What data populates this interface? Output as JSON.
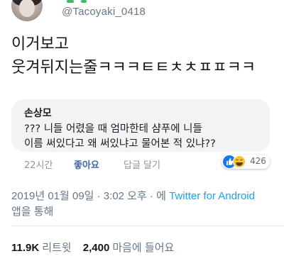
{
  "header": {
    "handle": "@Tacoyaki_0418"
  },
  "tweet": {
    "line1": "이거보고",
    "line2": "웃겨뒤지는줄ㅋㅋㅋㅌㅌㅊㅊㅍㅍㅋㅋ"
  },
  "comment": {
    "author": "손상모",
    "line1": "??? 니들 어렸을 때 엄마한테 샴푸에 니들",
    "line2": "이름 써있다고 왜 써있냐고 물어본 적 있냐??",
    "time": "22시간",
    "like_label": "좋아요",
    "reply_label": "답글 달기",
    "reaction_count": "426",
    "reaction_icons": [
      "like-icon",
      "haha-icon"
    ]
  },
  "meta": {
    "timestamp": "2019년 01월 09일 · 3:02 오후 · 에",
    "client_link": "Twitter for Android",
    "client_suffix": "앱을 통해"
  },
  "stats": {
    "retweets": "11.9K",
    "retweets_label": "리트윗",
    "likes": "2,400",
    "likes_label": "마음에 들어요"
  },
  "colors": {
    "link": "#1da1f2",
    "secondary_text": "#657786",
    "fb_like_blue": "#4267b2"
  }
}
